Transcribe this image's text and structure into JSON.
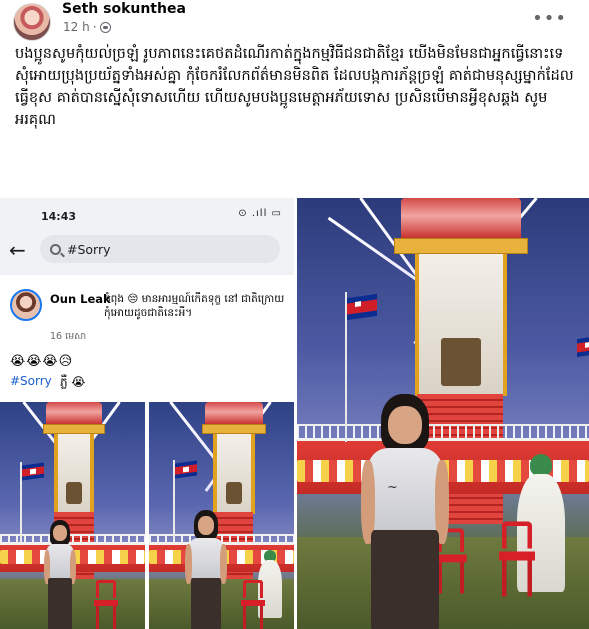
{
  "post": {
    "author": "Seth sokunthea",
    "time": "12 h",
    "separator": "·",
    "more_label": "•••",
    "caption": "បងប្អូនសូមកុំយល់ច្រឡំ រូបភាពនេះគេថតដំណើរកាត់ក្នុងកម្មវិធីជនជាតិខ្មែរ យើងមិនមែនជាអ្នកធ្វើនោះទេ សុំអោយប្រុងប្រយ័ត្នទាំងអស់គ្នា កុំចែករំលែកព័ត៌មានមិនពិត ដែលបង្កការភ័ន្តច្រឡំ គាត់ជាមនុស្សម្នាក់ដែលធ្វើខុស គាត់បានស្នើសុំទោសហើយ ហើយសូមបងប្អូនមេត្តាអភ័យទោស ប្រសិនបើមានអ្វីខុសឆ្គង សូមអរគុណ"
  },
  "screenshot": {
    "status_time": "14:43",
    "status_icons": "⊙ .ıll ▭",
    "back_label": "←",
    "search_text": "#Sorry",
    "inner_author": "Oun Leak",
    "inner_feeling": "កំពុង 😔 មានអារម្មណ៍កើតទុក្ខ នៅ ជាតិក្រោយកុំអោយដូចជាតិនេះអី។",
    "inner_date": "16 មេសា",
    "inner_emojis": "😭😭😭😥",
    "inner_hashtag": "#Sorry",
    "inner_hashtag_after": "ភ្លឺ 😭"
  },
  "icons": {
    "globe": "globe-icon",
    "more": "more-options-icon",
    "search": "search-icon",
    "back": "back-arrow-icon"
  },
  "colors": {
    "text": "#050505",
    "meta": "#65676b",
    "link": "#1a5fd0",
    "flag_blue": "#0b2d8f",
    "flag_red": "#d11f2a",
    "chair_red": "#d61f26"
  }
}
